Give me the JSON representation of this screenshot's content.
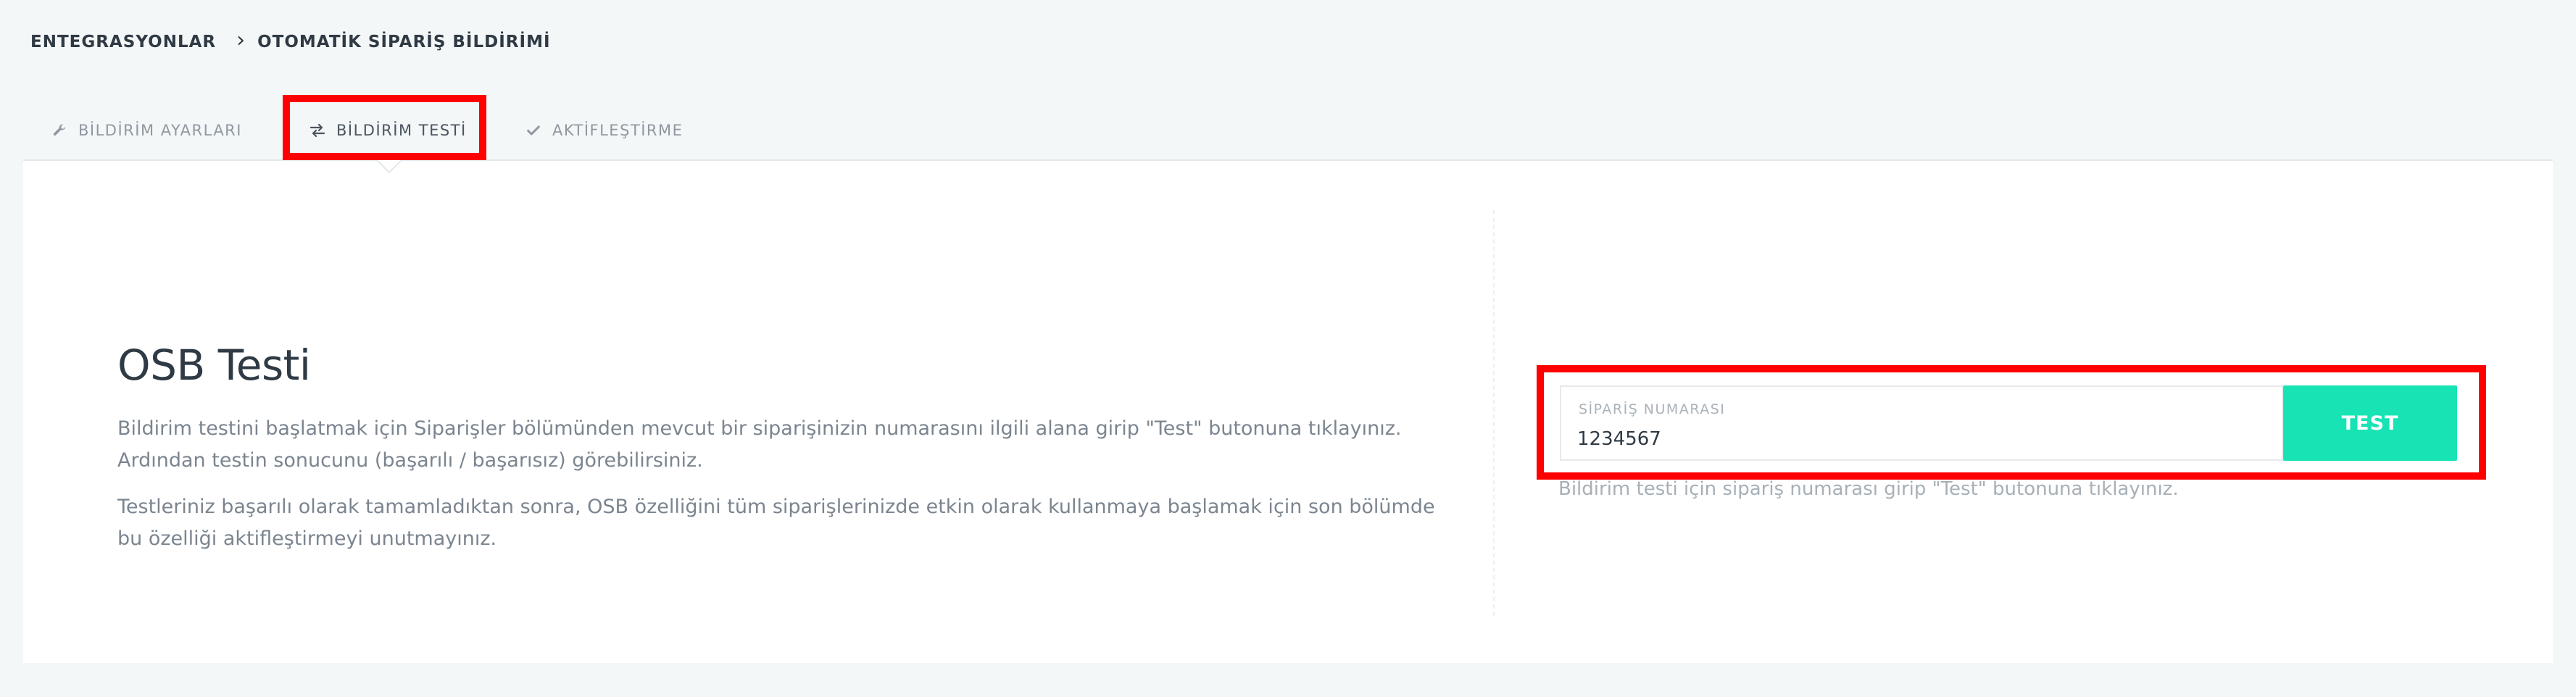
{
  "breadcrumb": {
    "root": "ENTEGRASYONLAR",
    "separator": "›",
    "current": "OTOMATİK SİPARİŞ BİLDİRİMİ"
  },
  "tabs": [
    {
      "label": "BİLDİRİM AYARLARI",
      "icon": "wrench-icon",
      "active": false
    },
    {
      "label": "BİLDİRİM TESTİ",
      "icon": "swap-arrows-icon",
      "active": true
    },
    {
      "label": "AKTİFLEŞTİRME",
      "icon": "check-icon",
      "active": false
    }
  ],
  "main": {
    "title": "OSB Testi",
    "paragraph_1": "Bildirim testini başlatmak için Siparişler bölümünden mevcut bir siparişinizin numarasını ilgili alana girip \"Test\" butonuna tıklayınız. Ardından testin sonucunu (başarılı / başarısız) görebilirsiniz.",
    "paragraph_2": "Testleriniz başarılı olarak tamamladıktan sonra, OSB özelliğini tüm siparişlerinizde etkin olarak kullanmaya başlamak için son bölümde bu özelliği aktifleştirmeyi unutmayınız."
  },
  "form": {
    "field_label": "SİPARİŞ NUMARASI",
    "order_number": "1234567",
    "button_label": "TEST",
    "help_text": "Bildirim testi için sipariş numarası girip \"Test\" butonuna tıklayınız."
  },
  "colors": {
    "accent": "#18e3b5",
    "highlight": "#ff0000",
    "background": "#f4f7f8"
  }
}
